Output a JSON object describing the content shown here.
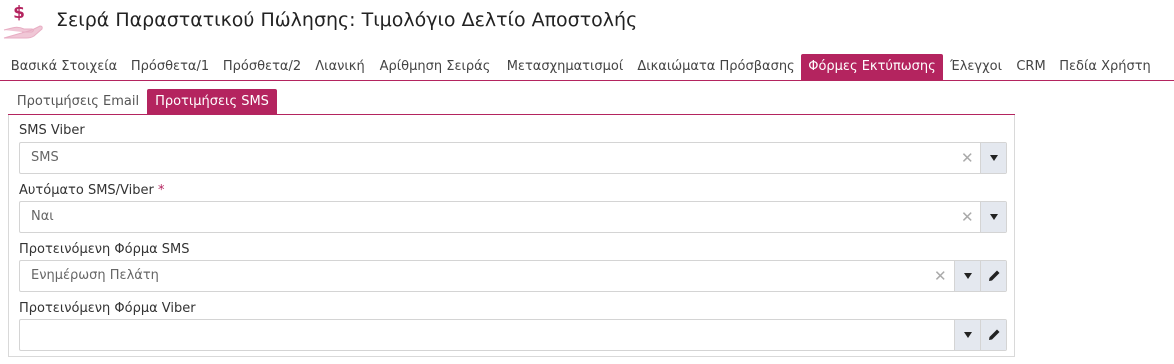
{
  "header": {
    "title": "Σειρά Παραστατικού Πώλησης: Τιμολόγιο Δελτίο Αποστολής",
    "icon": "hand-money-icon",
    "icon_color": "#b4245f"
  },
  "tabs": [
    {
      "label": "Βασικά Στοιχεία",
      "active": false
    },
    {
      "label": "Πρόσθετα/1",
      "active": false
    },
    {
      "label": "Πρόσθετα/2",
      "active": false
    },
    {
      "label": "Λιανική",
      "active": false
    },
    {
      "label": "Αρίθμηση Σειράς",
      "active": false
    },
    {
      "label": "Μετασχηματισμοί",
      "active": false
    },
    {
      "label": "Δικαιώματα Πρόσβασης",
      "active": false
    },
    {
      "label": "Φόρμες Εκτύπωσης",
      "active": true
    },
    {
      "label": "Έλεγχοι",
      "active": false
    },
    {
      "label": "CRM",
      "active": false
    },
    {
      "label": "Πεδία Χρήστη",
      "active": false
    }
  ],
  "subtabs": [
    {
      "label": "Προτιμήσεις Email",
      "active": false
    },
    {
      "label": "Προτιμήσεις SMS",
      "active": true
    }
  ],
  "fields": [
    {
      "label": "SMS Viber",
      "required": false,
      "value": "SMS",
      "clearable": true,
      "editable": false
    },
    {
      "label": "Αυτόματο SMS/Viber",
      "required": true,
      "required_mark": "*",
      "value": "Ναι",
      "clearable": true,
      "editable": false
    },
    {
      "label": "Προτεινόμενη Φόρμα SMS",
      "required": false,
      "value": "Ενημέρωση Πελάτη",
      "clearable": true,
      "editable": true
    },
    {
      "label": "Προτεινόμενη Φόρμα Viber",
      "required": false,
      "value": "",
      "clearable": false,
      "editable": true
    }
  ],
  "colors": {
    "accent": "#b4245f",
    "button_bg": "#e4e8ef"
  }
}
